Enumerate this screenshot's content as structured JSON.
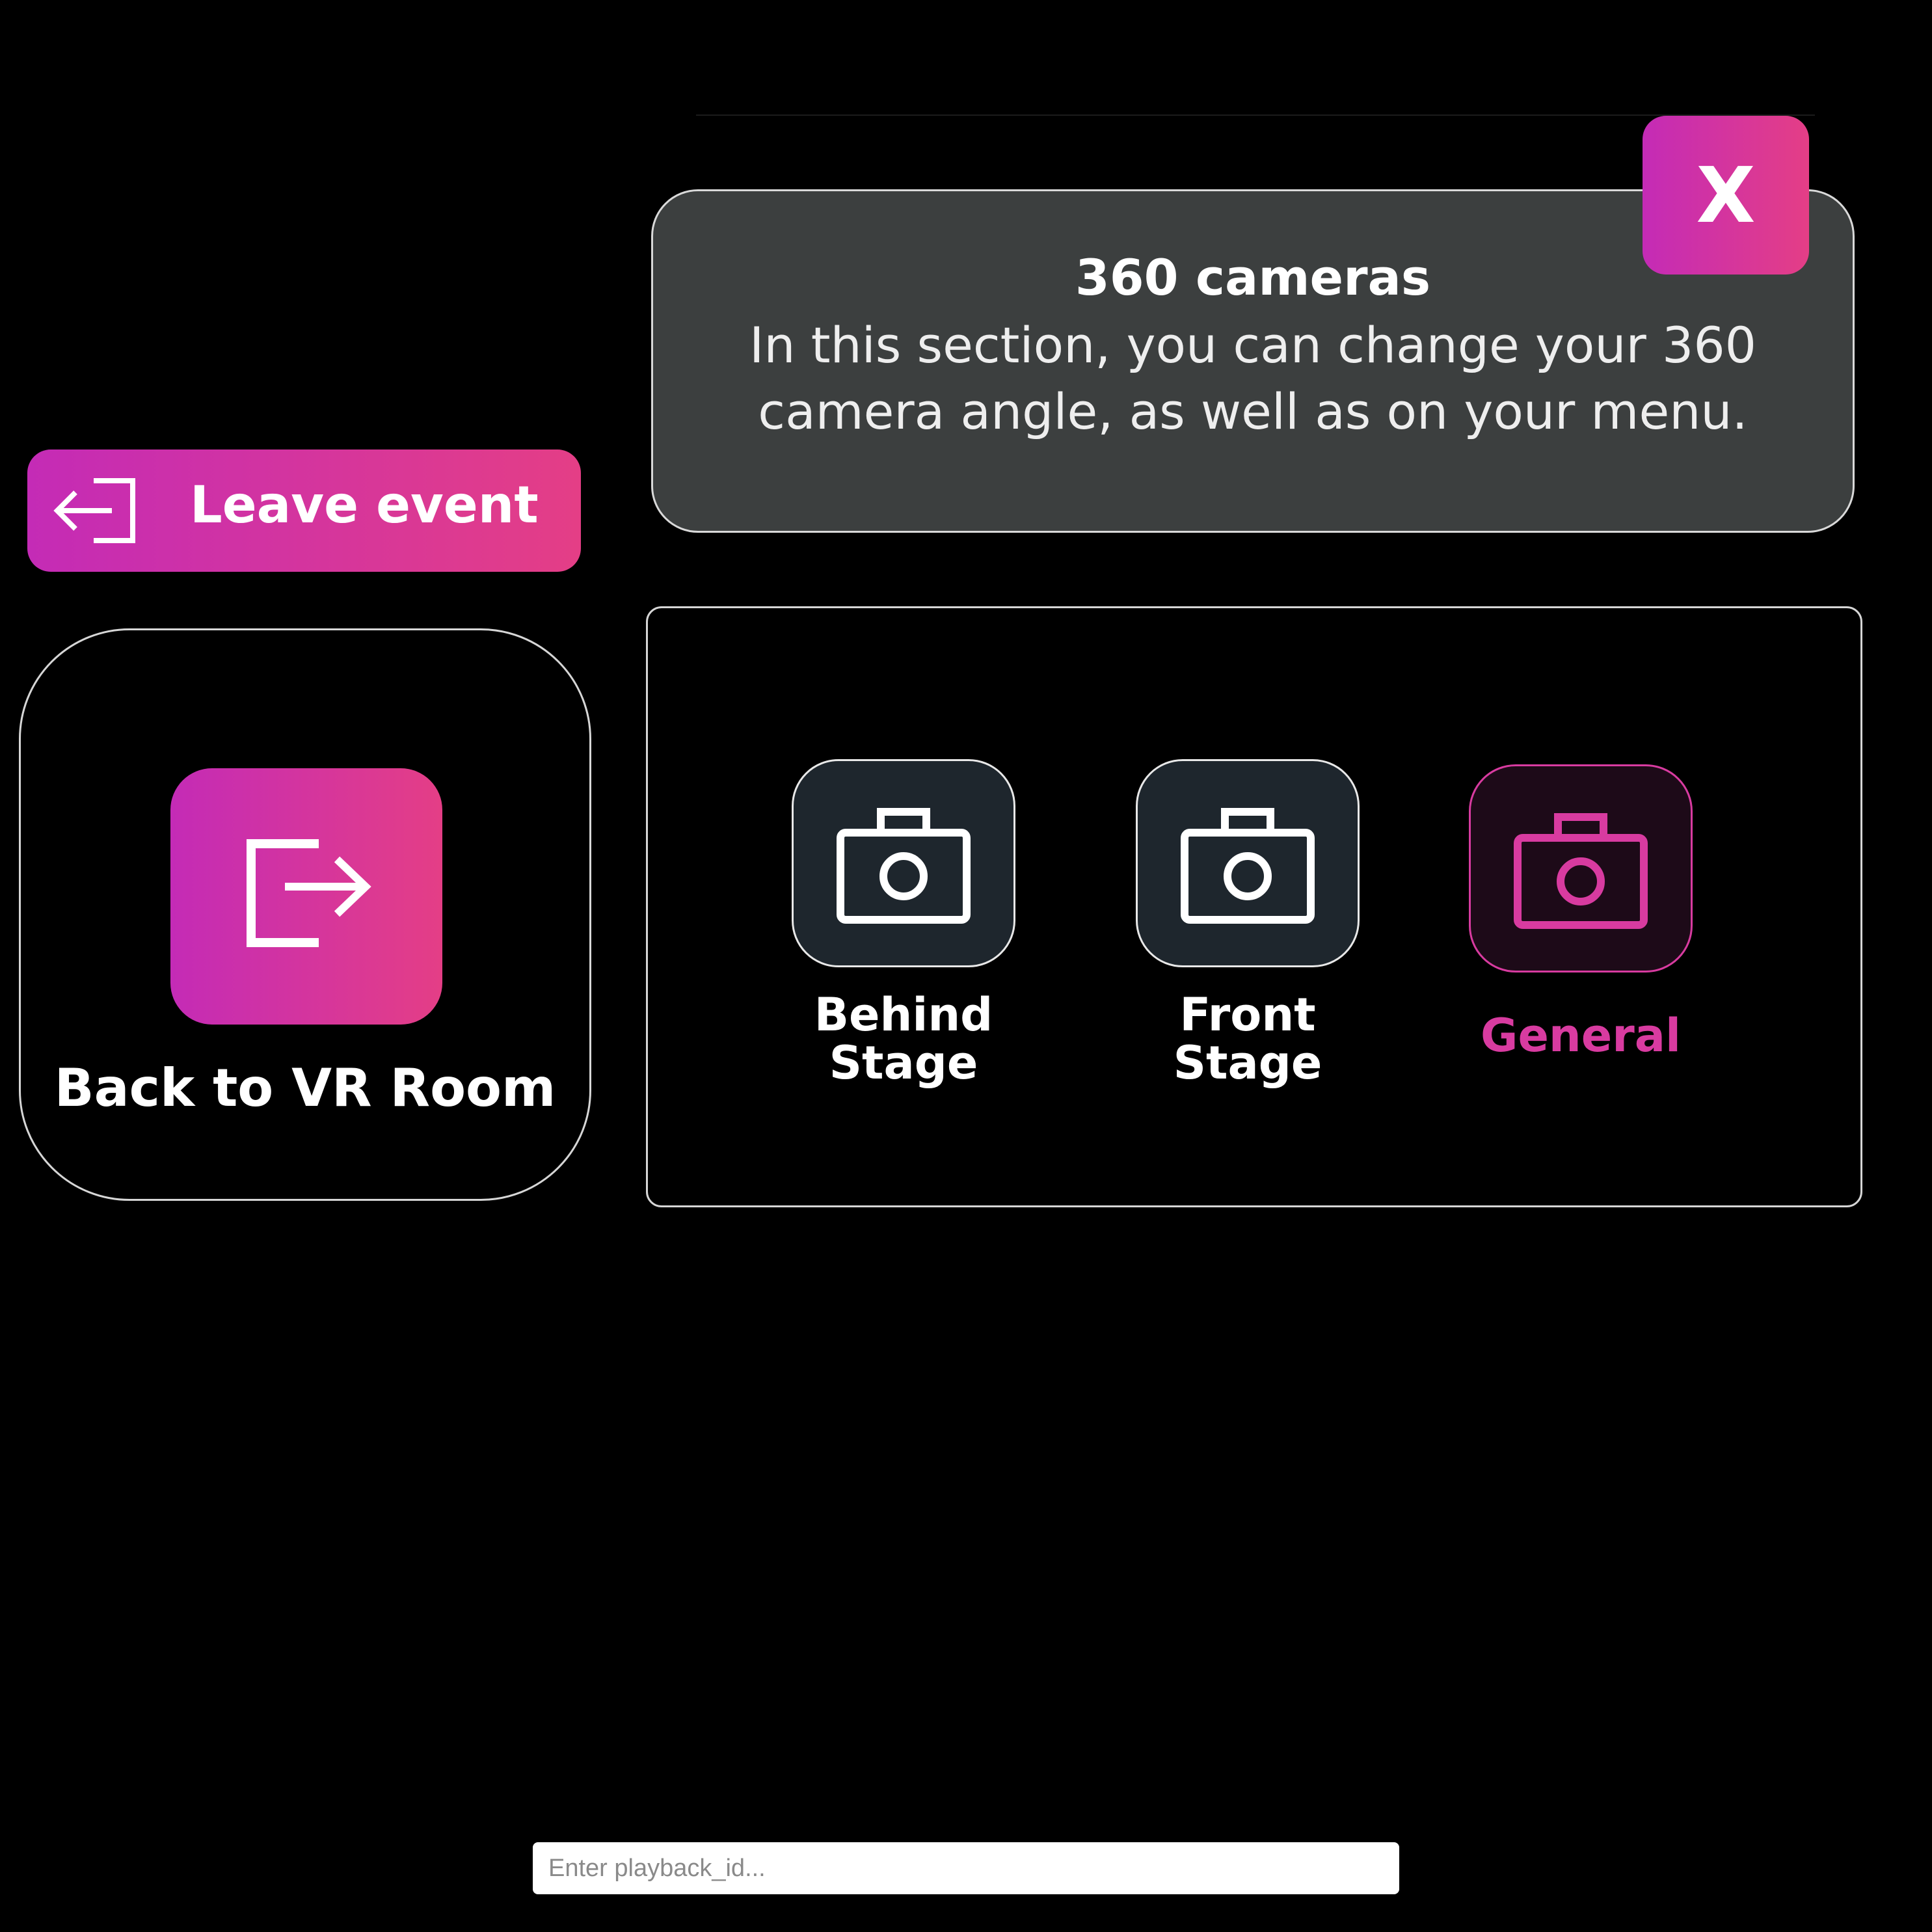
{
  "colors": {
    "accent_start": "#c42bb6",
    "accent_end": "#e43e86",
    "active_label": "#d83ba0",
    "info_card_bg": "#3c3f3f",
    "tile_bg": "#1e262d",
    "background": "#000000"
  },
  "info_card": {
    "title": "360 cameras",
    "description": "In this section, you can change your 360 camera angle, as well as on your menu."
  },
  "close_button": {
    "label": "X"
  },
  "leave_button": {
    "label": "Leave event",
    "icon": "exit-arrow-left-icon"
  },
  "back_card": {
    "label": "Back to VR Room",
    "icon": "logout-arrow-right-icon"
  },
  "cameras": {
    "selected": "General",
    "items": [
      {
        "label": "Behind Stage",
        "icon": "camera-icon",
        "active": false
      },
      {
        "label": "Front Stage",
        "icon": "camera-icon",
        "active": false
      },
      {
        "label": "General",
        "icon": "camera-icon",
        "active": true
      }
    ]
  },
  "playback": {
    "value": "",
    "placeholder": "Enter playback_id..."
  }
}
